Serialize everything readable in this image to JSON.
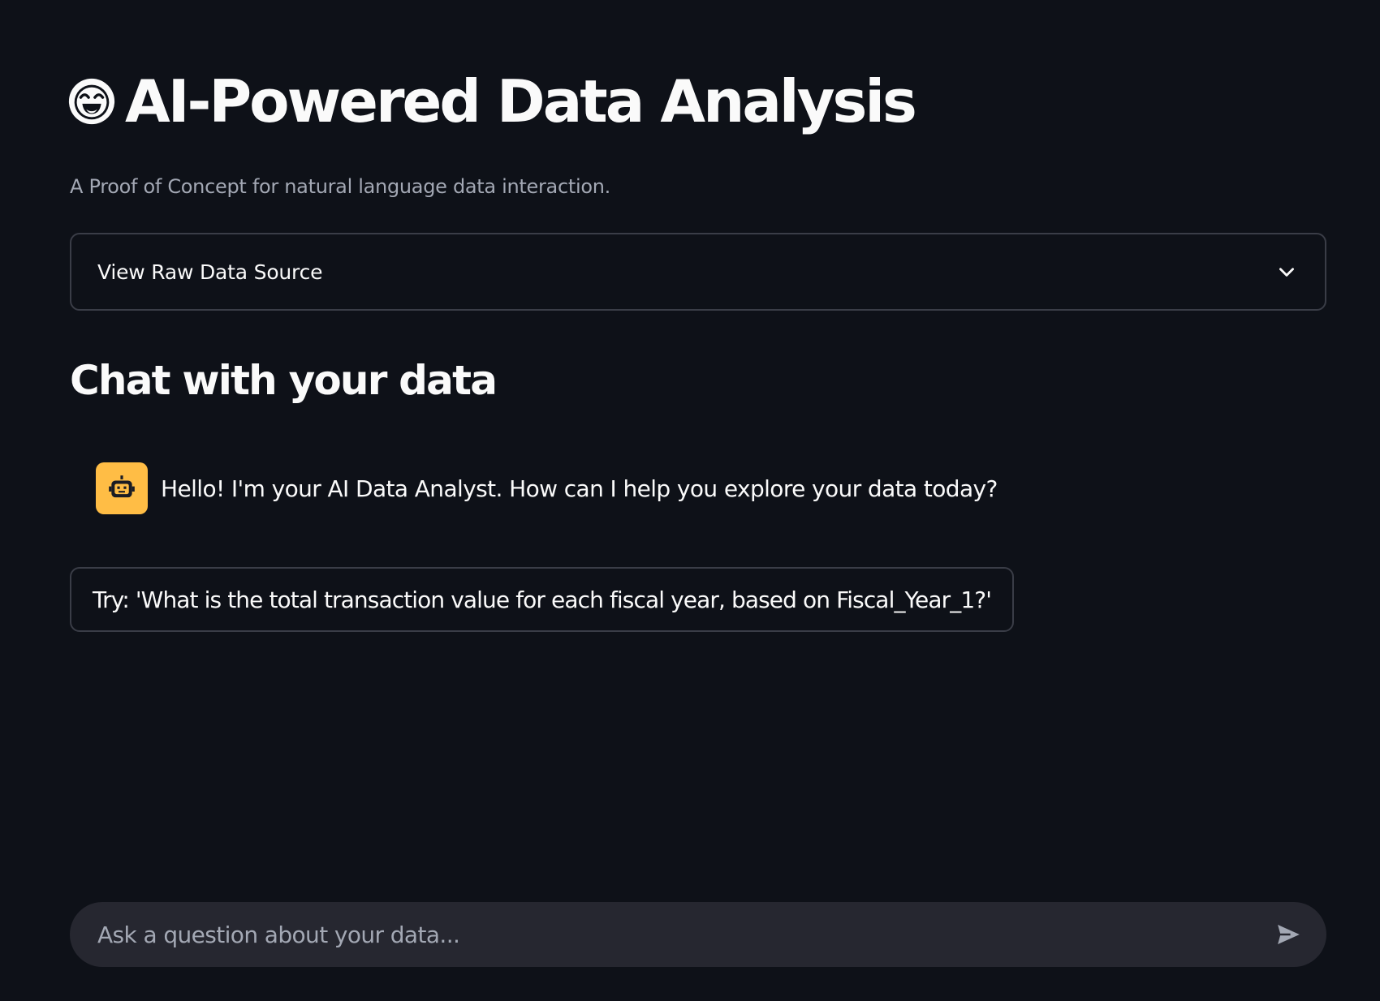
{
  "header": {
    "title": "AI-Powered Data Analysis",
    "title_icon": "grinning-face-emoji-icon",
    "subtitle": "A Proof of Concept for natural language data interaction."
  },
  "expander": {
    "label": "View Raw Data Source",
    "expanded": false,
    "icon": "chevron-down-icon"
  },
  "chat": {
    "section_title": "Chat with your data",
    "messages": [
      {
        "role": "assistant",
        "avatar_icon": "robot-icon",
        "text": "Hello! I'm your AI Data Analyst. How can I help you explore your data today?"
      }
    ],
    "suggestion": "Try: 'What is the total transaction value for each fiscal year, based on Fiscal_Year_1?'",
    "input": {
      "placeholder": "Ask a question about your data...",
      "value": "",
      "send_icon": "send-icon"
    }
  },
  "colors": {
    "background": "#0e1118",
    "text": "#fafafa",
    "muted_text": "#a3a8b4",
    "border": "#3a3d47",
    "input_background": "#262730",
    "avatar_accent": "#ffbd45"
  }
}
